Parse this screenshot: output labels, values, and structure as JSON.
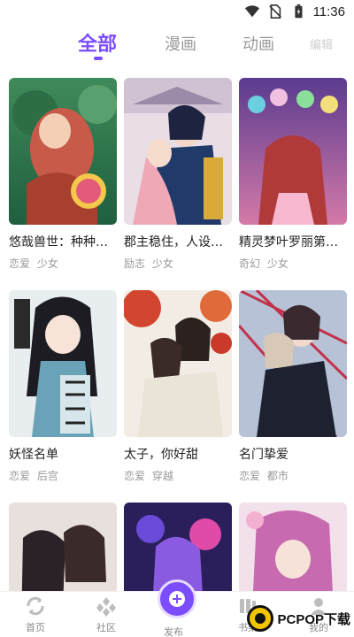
{
  "status_bar": {
    "time": "11:36",
    "icons": [
      "wifi-icon",
      "no-sim-icon",
      "battery-icon"
    ]
  },
  "tabs": [
    {
      "label": "全部",
      "active": true
    },
    {
      "label": "漫画",
      "active": false
    },
    {
      "label": "动画",
      "active": false
    },
    {
      "label": "编辑",
      "active": false
    }
  ],
  "comics": [
    {
      "title": "悠哉兽世：种种…",
      "tags": [
        "恋爱",
        "少女"
      ]
    },
    {
      "title": "郡主稳住，人设…",
      "tags": [
        "励志",
        "少女"
      ]
    },
    {
      "title": "精灵梦叶罗丽第…",
      "tags": [
        "奇幻",
        "少女"
      ]
    },
    {
      "title": "妖怪名单",
      "tags": [
        "恋爱",
        "后宫"
      ]
    },
    {
      "title": "太子，你好甜",
      "tags": [
        "恋爱",
        "穿越"
      ]
    },
    {
      "title": "名门挚爱",
      "tags": [
        "恋爱",
        "都市"
      ]
    },
    {
      "title": "",
      "tags": []
    },
    {
      "title": "",
      "tags": []
    },
    {
      "title": "",
      "tags": []
    }
  ],
  "bottom_nav": {
    "home": "首页",
    "community": "社区",
    "publish": "发布",
    "bookshelf": "书架",
    "mine": "我的"
  },
  "watermark": "PCPOP下载",
  "colors": {
    "accent": "#7b4dff",
    "inactive_text": "#9a9a9a"
  }
}
